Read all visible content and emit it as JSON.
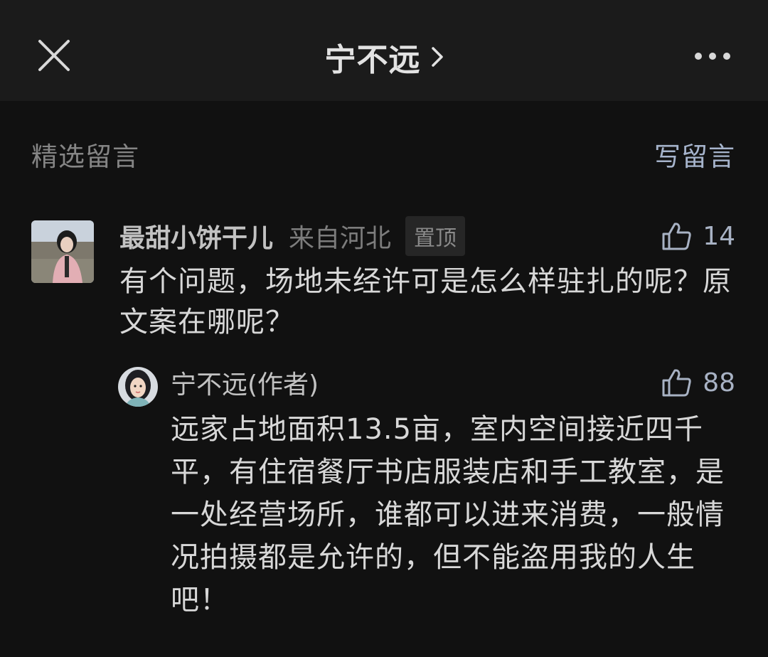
{
  "header": {
    "title": "宁不远",
    "close_icon": "close-icon",
    "chevron_icon": "chevron-right-icon",
    "more_icon": "more-dots-icon"
  },
  "section": {
    "title": "精选留言",
    "write_label": "写留言"
  },
  "comment": {
    "nickname": "最甜小饼干儿",
    "location": "来自河北",
    "badge": "置顶",
    "likes": "14",
    "text": "有个问题，场地未经许可是怎么样驻扎的呢？原文案在哪呢？"
  },
  "reply": {
    "name": "宁不远(作者)",
    "likes": "88",
    "text": "远家占地面积13.5亩，室内空间接近四千平，有住宿餐厅书店服装店和手工教室，是一处经营场所，谁都可以进来消费，一般情况拍摄都是允许的，但不能盗用我的人生吧！"
  },
  "colors": {
    "background": "#111111",
    "topbar": "#1b1b1b",
    "accent_link": "#a6b4cc",
    "muted_text": "#858585"
  }
}
